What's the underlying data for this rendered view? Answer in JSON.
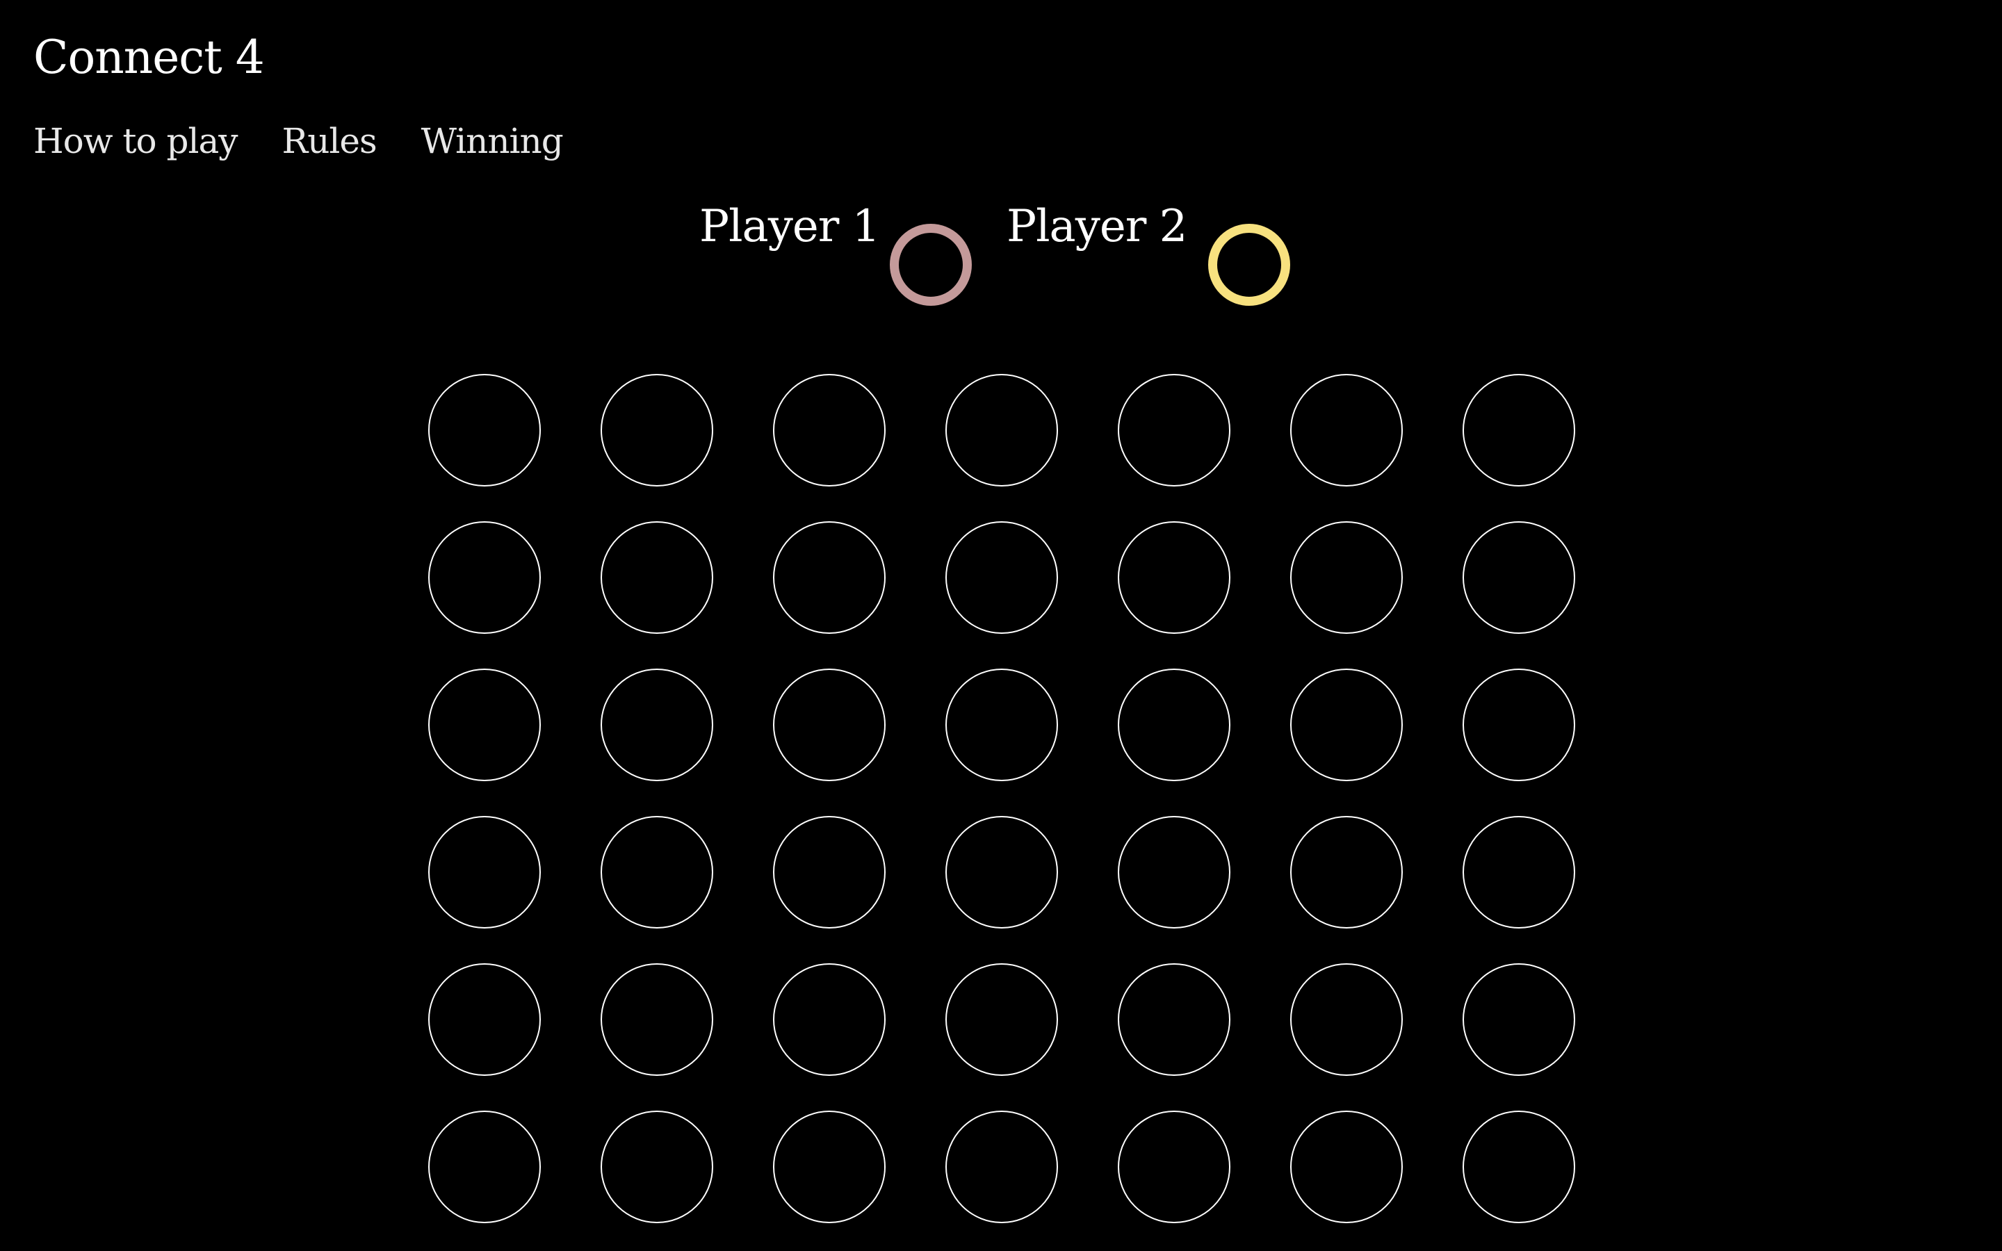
{
  "app": {
    "title": "Connect 4"
  },
  "nav": {
    "items": [
      {
        "id": "how-to-play",
        "label": "How to play"
      },
      {
        "id": "rules",
        "label": "Rules"
      },
      {
        "id": "winning",
        "label": "Winning"
      }
    ]
  },
  "players": [
    {
      "label": "Player 1",
      "token_color": "#c49a9a"
    },
    {
      "label": "Player 2",
      "token_color": "#f7e17f"
    }
  ],
  "board": {
    "rows": 6,
    "columns": 7,
    "cells": [
      [
        "empty",
        "empty",
        "empty",
        "empty",
        "empty",
        "empty",
        "empty"
      ],
      [
        "empty",
        "empty",
        "empty",
        "empty",
        "empty",
        "empty",
        "empty"
      ],
      [
        "empty",
        "empty",
        "empty",
        "empty",
        "empty",
        "empty",
        "empty"
      ],
      [
        "empty",
        "empty",
        "empty",
        "empty",
        "empty",
        "empty",
        "empty"
      ],
      [
        "empty",
        "empty",
        "empty",
        "empty",
        "empty",
        "empty",
        "empty"
      ],
      [
        "empty",
        "empty",
        "empty",
        "empty",
        "empty",
        "empty",
        "empty"
      ]
    ]
  },
  "colors": {
    "background": "#000000",
    "text": "#ffffff",
    "slot_outline": "#ffffff"
  }
}
